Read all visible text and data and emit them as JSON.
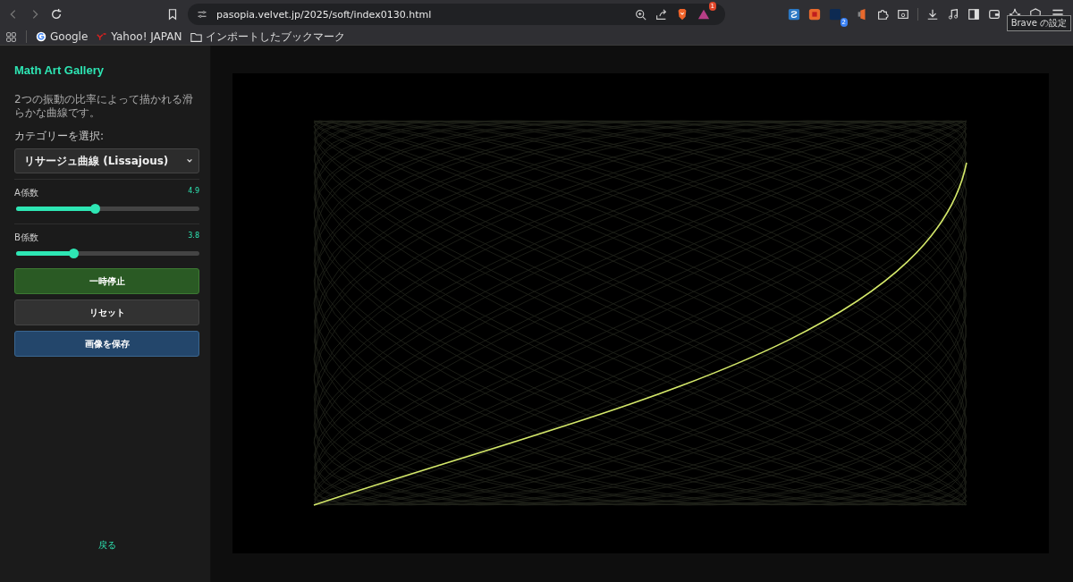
{
  "browser": {
    "url": "pasopia.velvet.jp/2025/soft/index0130.html",
    "rewards_badge": "1",
    "extension_badge": "2",
    "tooltip": "Brave の設定",
    "bookmarks": [
      {
        "label": "Google",
        "kind": "google"
      },
      {
        "label": "Yahoo! JAPAN",
        "kind": "yahoo"
      },
      {
        "label": "インポートしたブックマーク",
        "kind": "folder"
      }
    ]
  },
  "sidebar": {
    "title": "Math Art Gallery",
    "description": "2つの振動の比率によって描かれる滑らかな曲線です。",
    "category_label": "カテゴリーを選択:",
    "category_value": "リサージュ曲線 (Lissajous)",
    "sliders": [
      {
        "label": "A係数",
        "reading": "4.9",
        "level": 0.43
      },
      {
        "label": "B係数",
        "reading": "3.8",
        "level": 0.31
      }
    ],
    "buttons": [
      {
        "label": "一時停止",
        "kind": "pause"
      },
      {
        "label": "リセット",
        "kind": "reset"
      },
      {
        "label": "画像を保存",
        "kind": "save"
      }
    ],
    "back_link": "戻る"
  },
  "canvas": {
    "kind": "lissajous"
  }
}
